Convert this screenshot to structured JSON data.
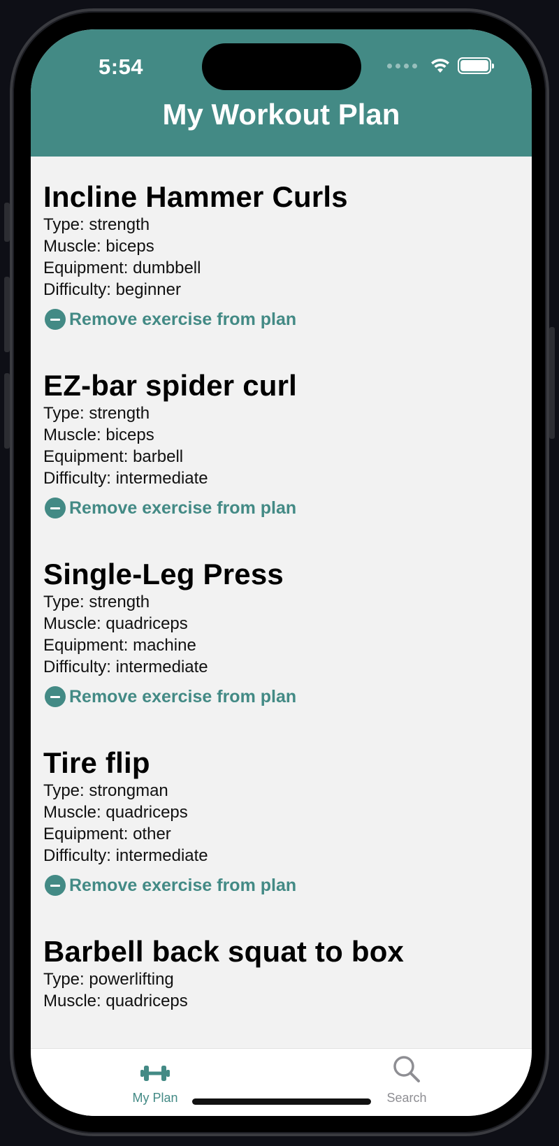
{
  "status_bar": {
    "time": "5:54"
  },
  "header": {
    "title": "My Workout Plan"
  },
  "exercises": [
    {
      "name": "Incline Hammer Curls",
      "type": "Type: strength",
      "muscle": "Muscle: biceps",
      "equipment": "Equipment: dumbbell",
      "difficulty": "Difficulty: beginner",
      "remove_label": "Remove exercise from plan"
    },
    {
      "name": "EZ-bar spider curl",
      "type": "Type: strength",
      "muscle": "Muscle: biceps",
      "equipment": "Equipment: barbell",
      "difficulty": "Difficulty: intermediate",
      "remove_label": "Remove exercise from plan"
    },
    {
      "name": "Single-Leg Press",
      "type": "Type: strength",
      "muscle": "Muscle: quadriceps",
      "equipment": "Equipment: machine",
      "difficulty": "Difficulty: intermediate",
      "remove_label": "Remove exercise from plan"
    },
    {
      "name": "Tire flip",
      "type": "Type: strongman",
      "muscle": "Muscle: quadriceps",
      "equipment": "Equipment: other",
      "difficulty": "Difficulty: intermediate",
      "remove_label": "Remove exercise from plan"
    },
    {
      "name": "Barbell back squat to box",
      "type": "Type: powerlifting",
      "muscle": "Muscle: quadriceps"
    }
  ],
  "tabs": [
    {
      "label": "My Plan",
      "icon": "dumbbell-icon",
      "active": true
    },
    {
      "label": "Search",
      "icon": "search-icon",
      "active": false
    }
  ],
  "colors": {
    "accent": "#438a85",
    "inactive": "#8e8e93",
    "background": "#f2f2f2"
  }
}
